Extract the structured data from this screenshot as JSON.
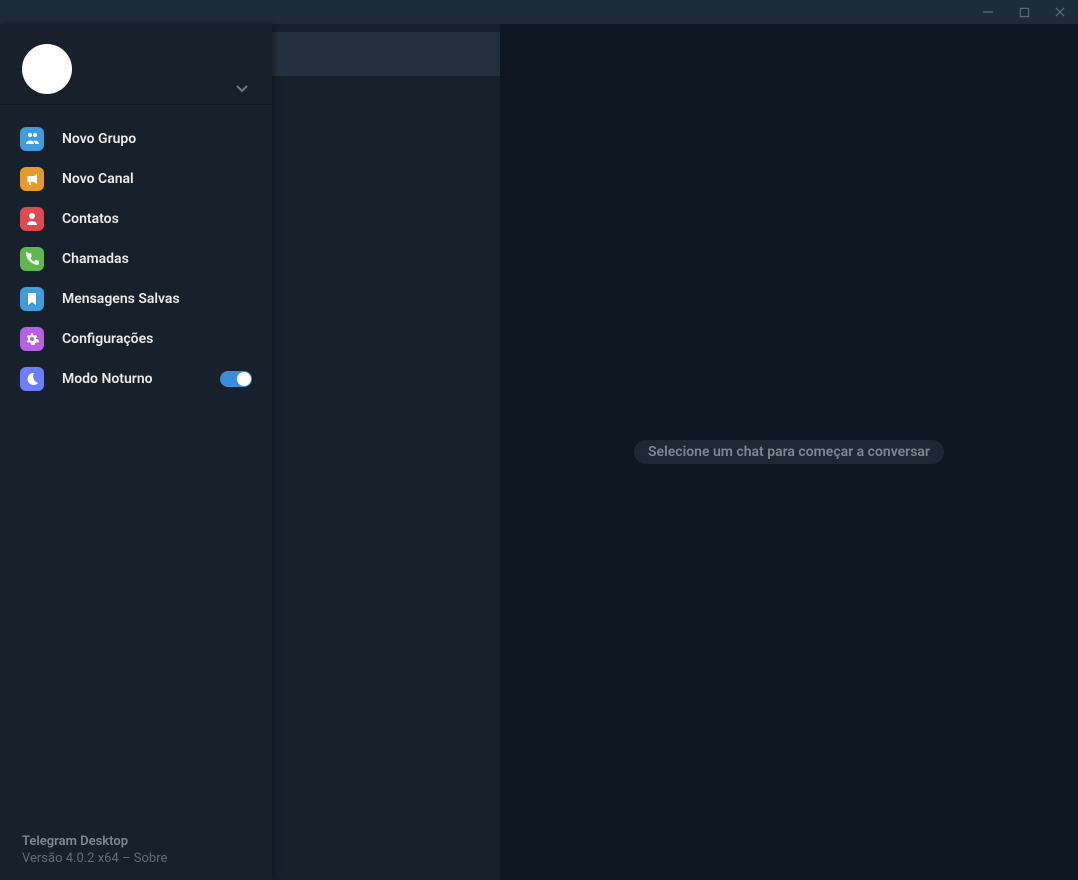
{
  "titlebar": {},
  "sidebar": {
    "menu": [
      {
        "id": "new-group",
        "label": "Novo Grupo",
        "icon": "group",
        "bg": "#429bdb"
      },
      {
        "id": "new-channel",
        "label": "Novo Canal",
        "icon": "megaphone",
        "bg": "#e69a2b"
      },
      {
        "id": "contacts",
        "label": "Contatos",
        "icon": "person",
        "bg": "#df4a52"
      },
      {
        "id": "calls",
        "label": "Chamadas",
        "icon": "phone",
        "bg": "#5eb84f"
      },
      {
        "id": "saved",
        "label": "Mensagens Salvas",
        "icon": "bookmark",
        "bg": "#429bdb"
      },
      {
        "id": "settings",
        "label": "Configurações",
        "icon": "gear",
        "bg": "#b461e4"
      },
      {
        "id": "night-mode",
        "label": "Modo Noturno",
        "icon": "moon",
        "bg": "#6c7eff",
        "toggle": true,
        "toggle_on": true
      }
    ]
  },
  "footer": {
    "title": "Telegram Desktop",
    "version": "Versão 4.0.2 x64 – Sobre"
  },
  "main": {
    "placeholder": "Selecione um chat para começar a conversar"
  }
}
